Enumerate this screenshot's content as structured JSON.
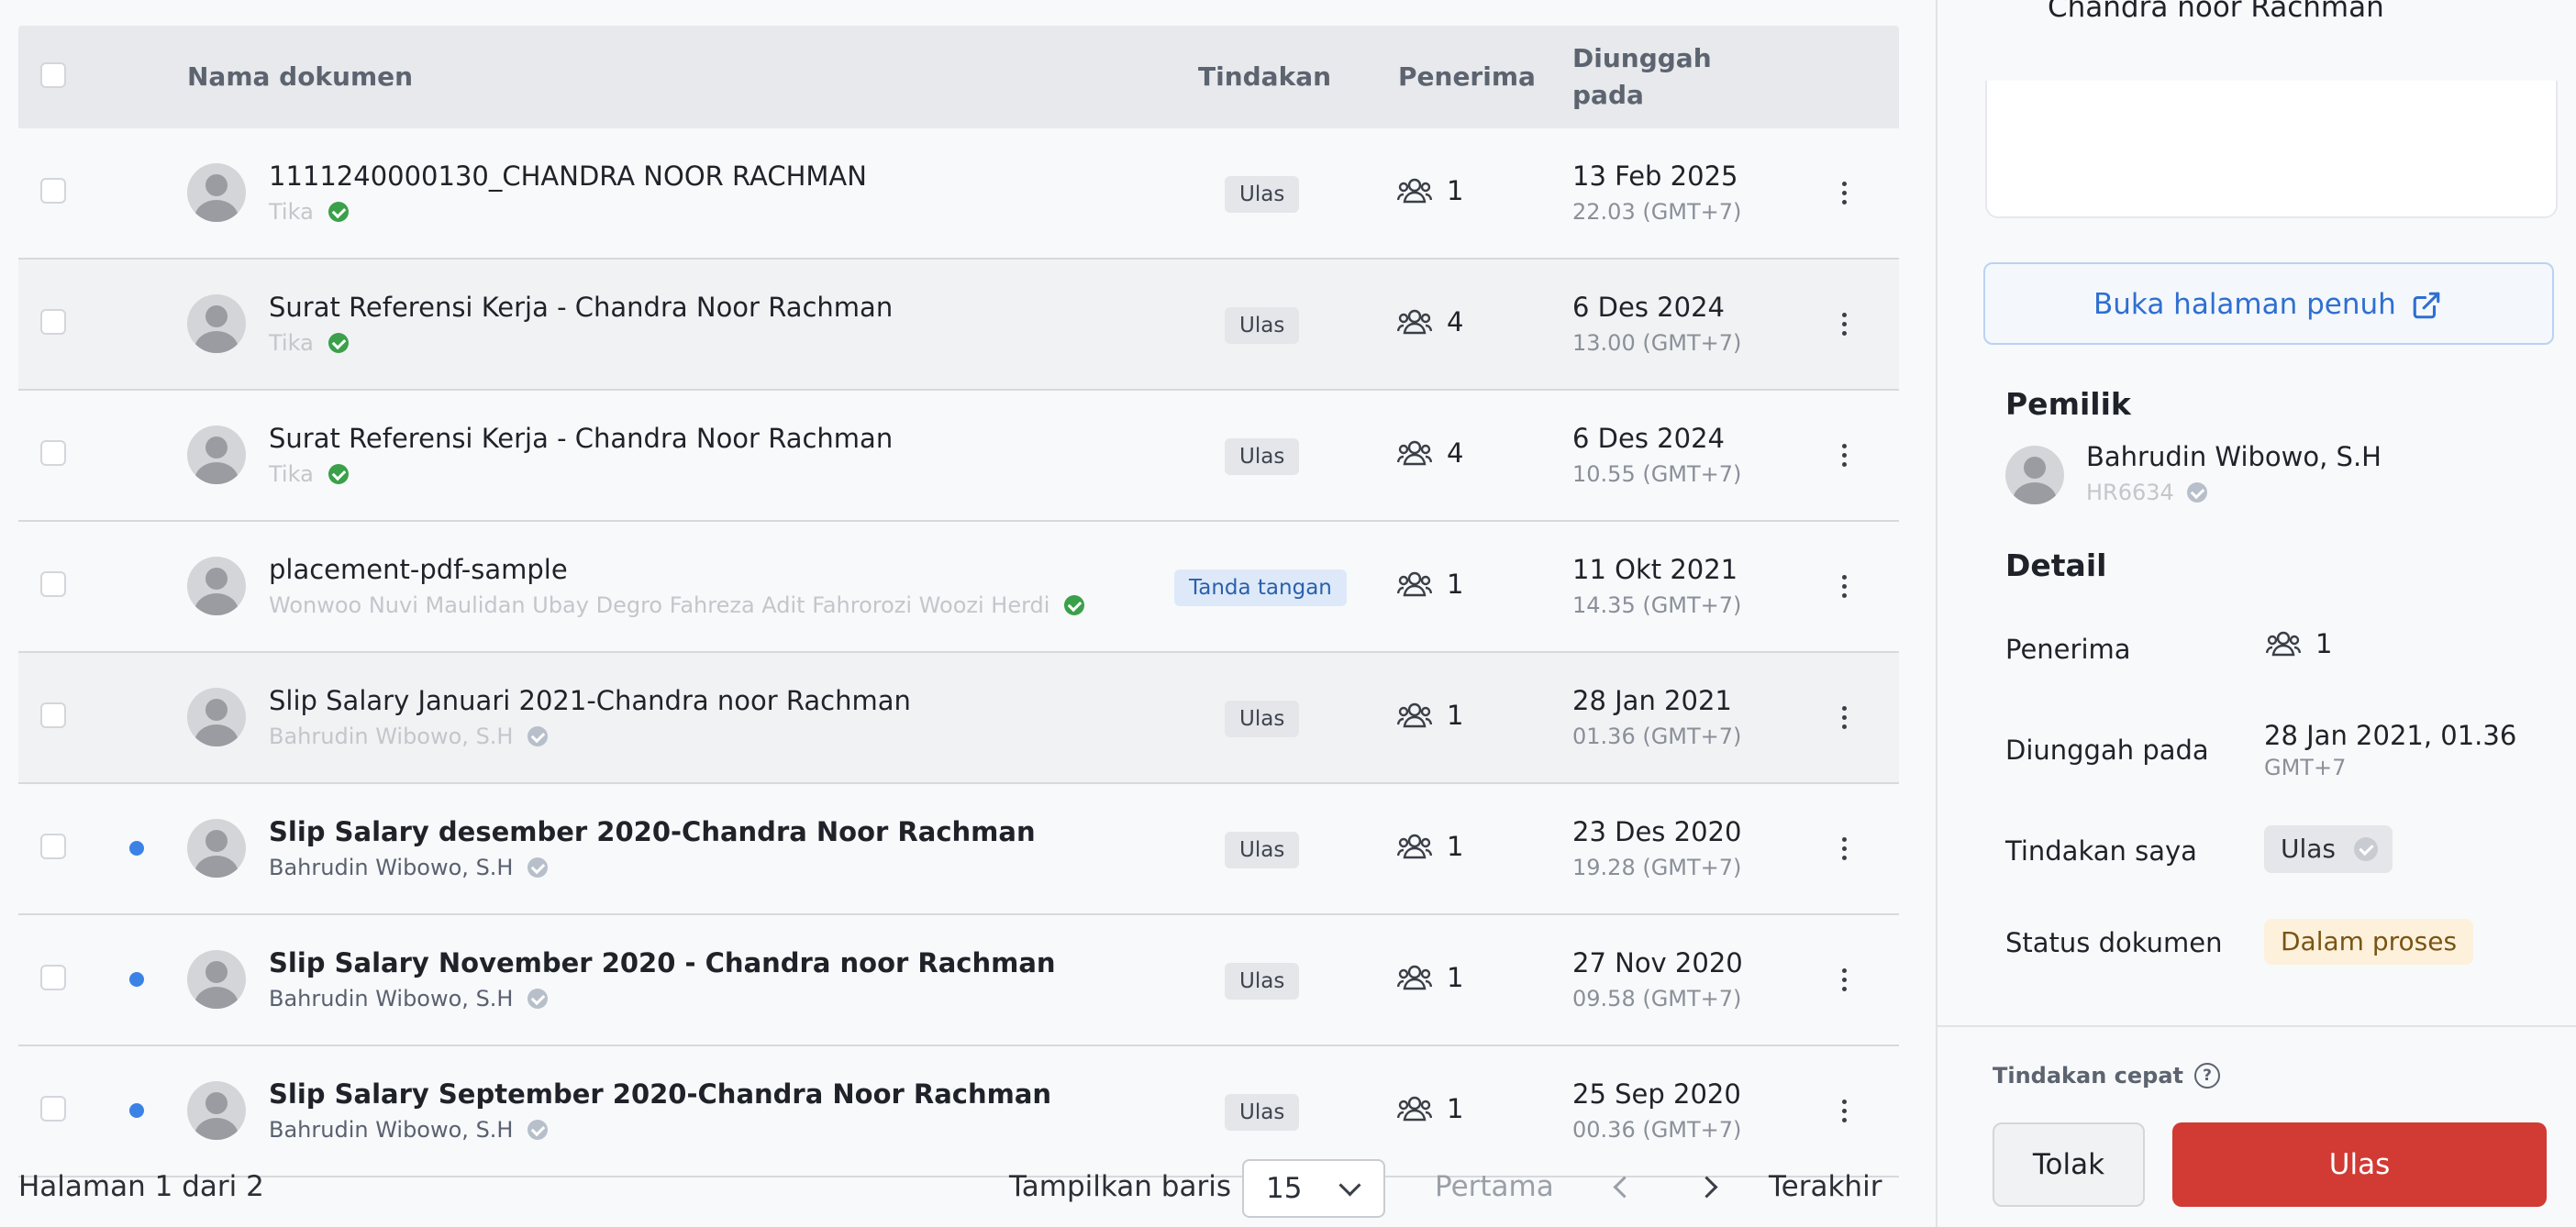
{
  "table": {
    "headers": {
      "name": "Nama dokumen",
      "action": "Tindakan",
      "recipients": "Penerima",
      "uploaded_line1": "Diunggah",
      "uploaded_line2": "pada"
    },
    "rows": [
      {
        "title": "1111240000130_CHANDRA NOOR RACHMAN",
        "sender": "Tika",
        "verify": "green",
        "action": "Ulas",
        "action_type": "review",
        "recipients": "1",
        "date": "13 Feb 2025",
        "time": "22.03 (GMT+7)",
        "unread": false,
        "alt": false
      },
      {
        "title": "Surat Referensi Kerja - Chandra Noor Rachman",
        "sender": "Tika",
        "verify": "green",
        "action": "Ulas",
        "action_type": "review",
        "recipients": "4",
        "date": "6 Des 2024",
        "time": "13.00 (GMT+7)",
        "unread": false,
        "alt": true
      },
      {
        "title": "Surat Referensi Kerja - Chandra Noor Rachman",
        "sender": "Tika",
        "verify": "green",
        "action": "Ulas",
        "action_type": "review",
        "recipients": "4",
        "date": "6 Des 2024",
        "time": "10.55 (GMT+7)",
        "unread": false,
        "alt": false
      },
      {
        "title": "placement-pdf-sample",
        "sender": "Wonwoo Nuvi Maulidan Ubay Degro Fahreza Adit Fahrorozi Woozi Herdi",
        "verify": "green",
        "action": "Tanda tangan",
        "action_type": "sign",
        "recipients": "1",
        "date": "11 Okt 2021",
        "time": "14.35 (GMT+7)",
        "unread": false,
        "alt": false
      },
      {
        "title": "Slip Salary Januari 2021-Chandra noor Rachman",
        "sender": "Bahrudin Wibowo, S.H",
        "verify": "gray",
        "action": "Ulas",
        "action_type": "review",
        "recipients": "1",
        "date": "28 Jan 2021",
        "time": "01.36 (GMT+7)",
        "unread": false,
        "alt": true
      },
      {
        "title": "Slip Salary desember 2020-Chandra Noor Rachman",
        "sender": "Bahrudin Wibowo, S.H",
        "verify": "gray",
        "action": "Ulas",
        "action_type": "review",
        "recipients": "1",
        "date": "23 Des 2020",
        "time": "19.28 (GMT+7)",
        "unread": true,
        "alt": false
      },
      {
        "title": "Slip Salary November 2020 - Chandra noor Rachman",
        "sender": "Bahrudin Wibowo, S.H",
        "verify": "gray",
        "action": "Ulas",
        "action_type": "review",
        "recipients": "1",
        "date": "27 Nov 2020",
        "time": "09.58 (GMT+7)",
        "unread": true,
        "alt": false
      },
      {
        "title": "Slip Salary September 2020-Chandra Noor Rachman",
        "sender": "Bahrudin Wibowo, S.H",
        "verify": "gray",
        "action": "Ulas",
        "action_type": "review",
        "recipients": "1",
        "date": "25 Sep 2020",
        "time": "00.36 (GMT+7)",
        "unread": true,
        "alt": false
      }
    ]
  },
  "pagination": {
    "page_info": "Halaman 1 dari 2",
    "rows_label": "Tampilkan baris",
    "rows_value": "15",
    "first": "Pertama",
    "last": "Terakhir"
  },
  "detail": {
    "top_name": "Chandra noor Rachman",
    "open_full": "Buka halaman penuh",
    "owner_title": "Pemilik",
    "owner_name": "Bahrudin Wibowo, S.H",
    "owner_id": "HR6634",
    "detail_title": "Detail",
    "recipients_label": "Penerima",
    "recipients_value": "1",
    "uploaded_label": "Diunggah pada",
    "uploaded_value": "28 Jan 2021, 01.36",
    "uploaded_tz": "GMT+7",
    "my_action_label": "Tindakan saya",
    "my_action_value": "Ulas",
    "status_label": "Status dokumen",
    "status_value": "Dalam proses",
    "quick_title": "Tindakan cepat",
    "reject_label": "Tolak",
    "review_label": "Ulas"
  },
  "colors": {
    "accent_blue": "#2f6fd0",
    "primary_red": "#d23a34",
    "verified_green": "#3aa04a",
    "unread_dot": "#3b82e6",
    "status_bg": "#fdf1dc"
  },
  "icons": [
    "checkbox",
    "avatar",
    "verified-badge-icon",
    "users-icon",
    "kebab-menu-icon",
    "chevron-down-icon",
    "chevron-left-icon",
    "chevron-right-icon",
    "external-link-icon",
    "help-icon",
    "check-icon"
  ]
}
